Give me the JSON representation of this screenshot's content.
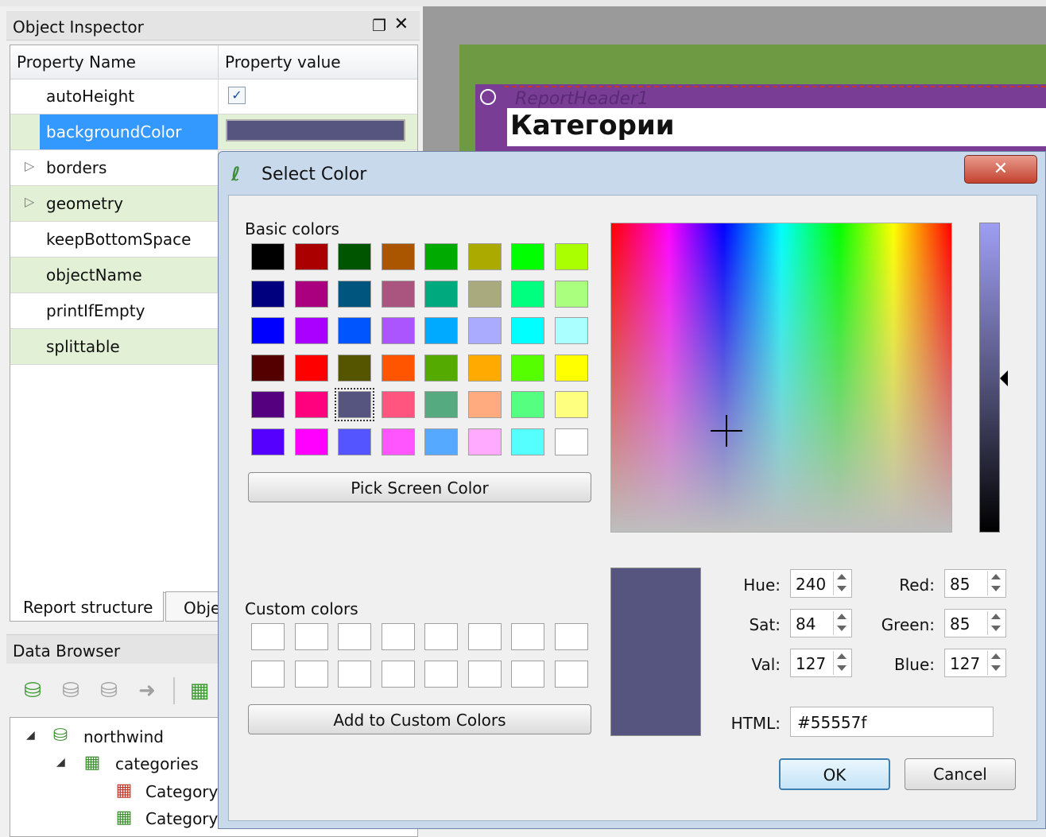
{
  "object_inspector": {
    "title": "Object Inspector",
    "col_name": "Property Name",
    "col_value": "Property value",
    "rows": [
      {
        "name": "autoHeight",
        "checked": true
      },
      {
        "name": "backgroundColor",
        "color": "#55557f"
      },
      {
        "name": "borders"
      },
      {
        "name": "geometry"
      },
      {
        "name": "keepBottomSpace"
      },
      {
        "name": "objectName"
      },
      {
        "name": "printIfEmpty"
      },
      {
        "name": "splittable"
      }
    ],
    "tabs": [
      "Report structure",
      "Obje"
    ]
  },
  "data_browser": {
    "title": "Data Browser",
    "tree": {
      "db": "northwind",
      "table": "categories",
      "fields": [
        "Category",
        "Category"
      ]
    }
  },
  "designer": {
    "ghost_text": "ReportHeader1",
    "title_text": "Категории"
  },
  "dialog": {
    "title": "Select Color",
    "basic_label": "Basic colors",
    "custom_label": "Custom colors",
    "pick_label": "Pick Screen Color",
    "add_label": "Add to Custom Colors",
    "ok_label": "OK",
    "cancel_label": "Cancel",
    "basic_colors": [
      [
        "#000000",
        "#aa0000",
        "#005500",
        "#aa5500",
        "#00aa00",
        "#aaaa00",
        "#00ff00",
        "#aaff00"
      ],
      [
        "#00007f",
        "#aa007f",
        "#00557f",
        "#aa557f",
        "#00aa7f",
        "#aaaa7f",
        "#00ff7f",
        "#aaff7f"
      ],
      [
        "#0000ff",
        "#aa00ff",
        "#0055ff",
        "#aa55ff",
        "#00aaff",
        "#aaaaff",
        "#00ffff",
        "#aaffff"
      ],
      [
        "#550000",
        "#ff0000",
        "#555500",
        "#ff5500",
        "#55aa00",
        "#ffaa00",
        "#55ff00",
        "#ffff00"
      ],
      [
        "#55007f",
        "#ff007f",
        "#55557f",
        "#ff557f",
        "#55aa7f",
        "#ffaa7f",
        "#55ff7f",
        "#ffff7f"
      ],
      [
        "#5500ff",
        "#ff00ff",
        "#5555ff",
        "#ff55ff",
        "#55aaff",
        "#ffaaff",
        "#55ffff",
        "#ffffff"
      ]
    ],
    "selected_color": "#55557f",
    "fields": {
      "hue_label": "Hue:",
      "hue": "240",
      "sat_label": "Sat:",
      "sat": "84",
      "val_label": "Val:",
      "val": "127",
      "red_label": "Red:",
      "red": "85",
      "green_label": "Green:",
      "green": "85",
      "blue_label": "Blue:",
      "blue": "127",
      "html_label": "HTML:",
      "html": "#55557f"
    }
  }
}
